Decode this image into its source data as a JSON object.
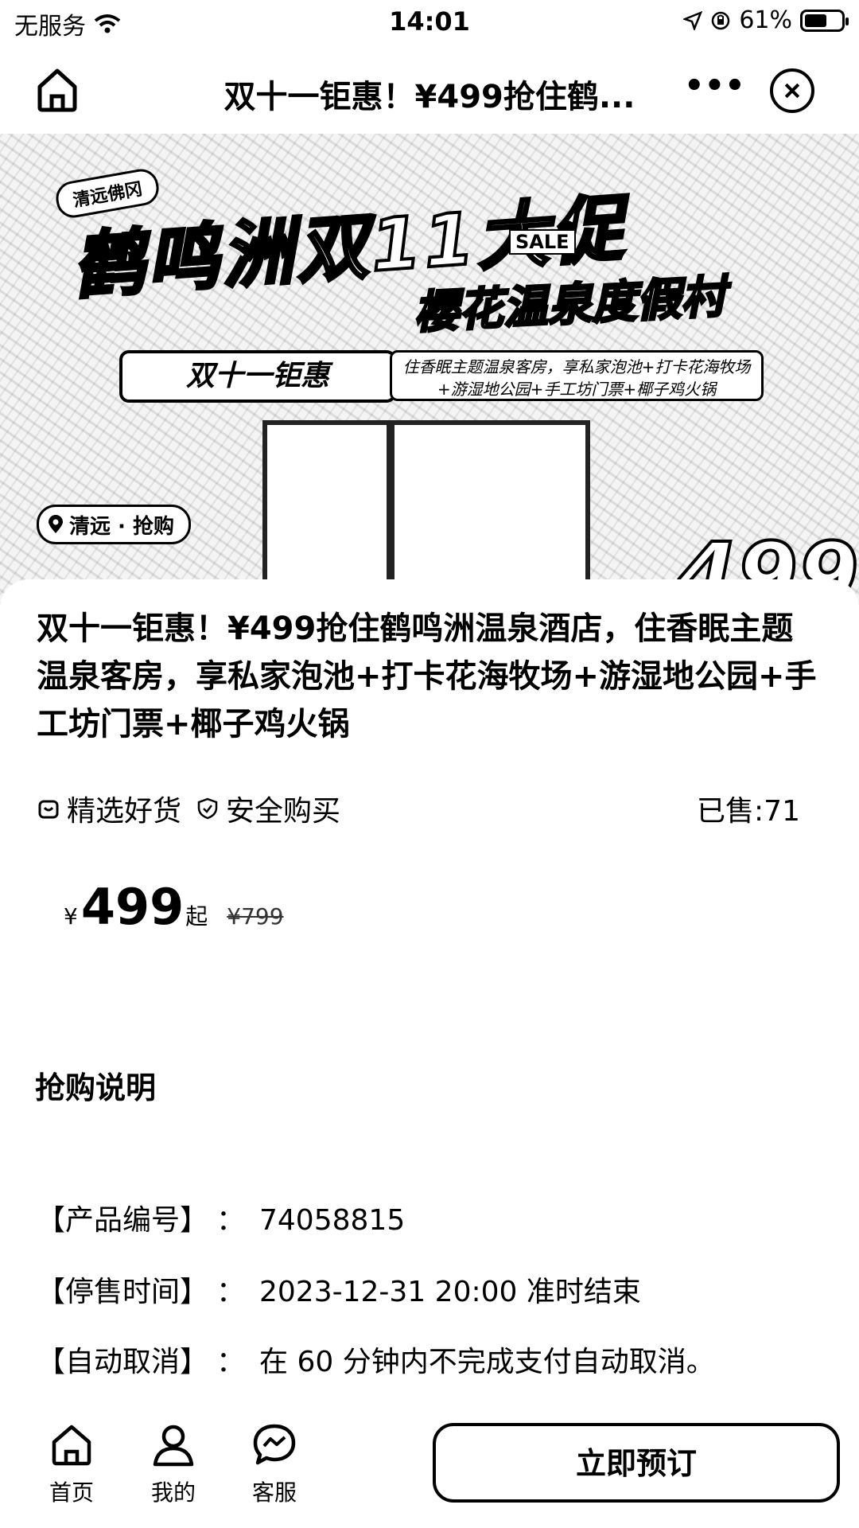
{
  "status_bar": {
    "carrier": "无服务",
    "time": "14:01",
    "battery_pct": "61%",
    "battery_level": 0.61,
    "icons": [
      "wifi-icon",
      "location-arrow-icon",
      "orientation-lock-icon",
      "battery-icon"
    ]
  },
  "nav": {
    "title": "双十一钜惠！¥499抢住鹤...",
    "more_label": "•••",
    "icons": [
      "home-icon",
      "more-icon",
      "close-icon"
    ]
  },
  "banner": {
    "brand": "清远佛冈",
    "headline": "鹤鸣洲双11大促",
    "sale_tag": "SALE",
    "subtitle": "樱花温泉度假村",
    "pill": "双十一钜惠",
    "features_line1": "住香眠主题温泉客房，享私家泡池+打卡花海牧场",
    "features_line2": "+游湿地公园+手工坊门票+椰子鸡火锅",
    "location": "清远 · 抢购",
    "price": "499"
  },
  "product": {
    "title": "双十一钜惠！¥499抢住鹤鸣洲温泉酒店，住香眠主题温泉客房，享私家泡池+打卡花海牧场+游湿地公园+手工坊门票+椰子鸡火锅",
    "tags": [
      "精选好货",
      "安全购买"
    ],
    "sold": "已售:71",
    "price_currency": "¥",
    "price_value": "499",
    "price_suffix": "起",
    "price_original": "¥799"
  },
  "details": {
    "section_title": "抢购说明",
    "rows": [
      {
        "label": "【产品编号】",
        "sep": "：",
        "value": "74058815"
      },
      {
        "label": "【停售时间】",
        "sep": "：",
        "value": "2023-12-31 20:00 准时结束"
      },
      {
        "label": "【自动取消】",
        "sep": "：",
        "value": "在 60 分钟内不完成支付自动取消。"
      }
    ]
  },
  "bottom_bar": {
    "tabs": [
      {
        "label": "首页",
        "icon": "home-icon"
      },
      {
        "label": "我的",
        "icon": "user-icon"
      },
      {
        "label": "客服",
        "icon": "chat-icon"
      }
    ],
    "book_label": "立即预订"
  }
}
